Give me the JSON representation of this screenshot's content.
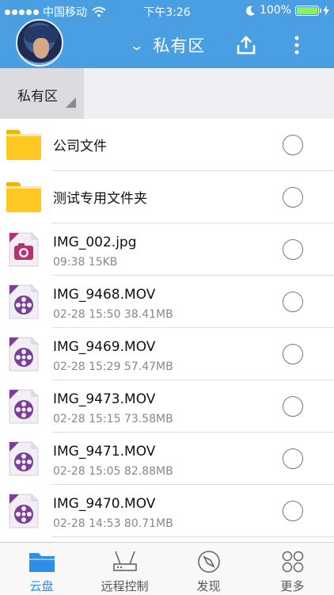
{
  "status_bar": {
    "carrier": "中国移动",
    "time": "下午3:26",
    "battery": "100%"
  },
  "header": {
    "title": "私有区",
    "icons": [
      "avatar",
      "chevron-down-icon",
      "upload-icon",
      "more-vertical-icon"
    ]
  },
  "breadcrumb": {
    "label": "私有区"
  },
  "files": [
    {
      "name": "公司文件",
      "meta": "",
      "type": "folder"
    },
    {
      "name": "测试专用文件夹",
      "meta": "",
      "type": "folder"
    },
    {
      "name": "IMG_002.jpg",
      "meta": "09:38  15KB",
      "type": "image"
    },
    {
      "name": "IMG_9468.MOV",
      "meta": "02-28 15:50  38.41MB",
      "type": "video"
    },
    {
      "name": "IMG_9469.MOV",
      "meta": "02-28 15:29  57.47MB",
      "type": "video"
    },
    {
      "name": "IMG_9473.MOV",
      "meta": "02-28 15:15  73.58MB",
      "type": "video"
    },
    {
      "name": "IMG_9471.MOV",
      "meta": "02-28 15:05  82.88MB",
      "type": "video"
    },
    {
      "name": "IMG_9470.MOV",
      "meta": "02-28 14:53  80.71MB",
      "type": "video"
    }
  ],
  "tabbar": [
    {
      "label": "云盘",
      "icon": "folder-icon",
      "active": true
    },
    {
      "label": "远程控制",
      "icon": "router-icon",
      "active": false
    },
    {
      "label": "发现",
      "icon": "compass-icon",
      "active": false
    },
    {
      "label": "更多",
      "icon": "grid-circles-icon",
      "active": false
    }
  ],
  "colors": {
    "header_bg": "#4a9fe2",
    "accent": "#2e8de6",
    "folder": "#ffc822",
    "video_icon": "#7b3f9a",
    "image_icon": "#b3336f"
  }
}
